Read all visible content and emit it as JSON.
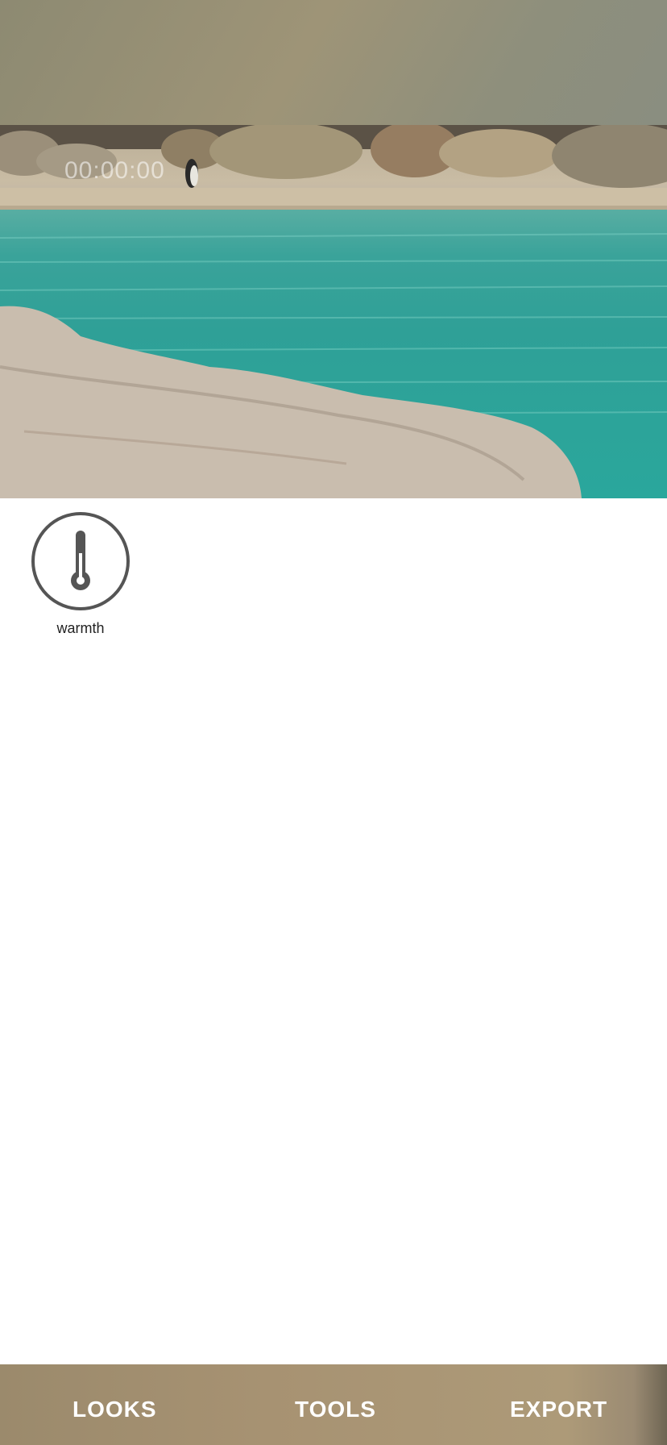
{
  "preview": {
    "timecode": "00:00:00"
  },
  "tools": {
    "items": [
      {
        "label": "warmth",
        "icon": "thermometer-icon"
      }
    ]
  },
  "bottom_nav": {
    "looks": "LOOKS",
    "tools": "TOOLS",
    "export": "EXPORT"
  }
}
